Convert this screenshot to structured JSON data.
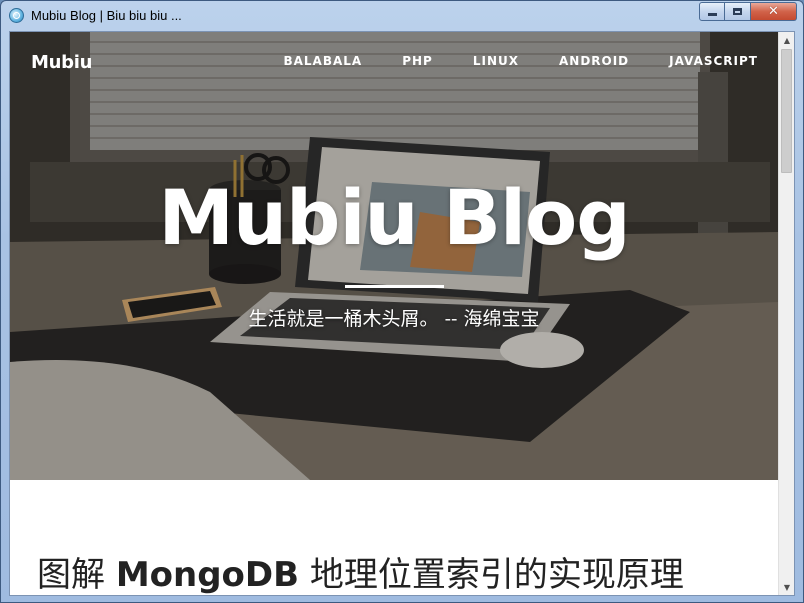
{
  "window": {
    "title": "Mubiu Blog | Biu biu biu ...",
    "minimize_glyph": "",
    "close_glyph": "✕"
  },
  "nav": {
    "brand": "Mubiu",
    "items": [
      {
        "label": "BALABALA"
      },
      {
        "label": "PHP"
      },
      {
        "label": "LINUX"
      },
      {
        "label": "ANDROID"
      },
      {
        "label": "JAVASCRIPT"
      }
    ]
  },
  "hero": {
    "title": "Mubiu Blog",
    "subtitle": "生活就是一桶木头屑。 -- 海绵宝宝"
  },
  "post": {
    "title_prefix": "图解 ",
    "title_latin": "MongoDB",
    "title_suffix": " 地理位置索引的实现原理"
  },
  "scrollbar": {
    "up_glyph": "▲",
    "down_glyph": "▼"
  },
  "colors": {
    "close_button": "#c44a30",
    "titlebar": "#a8c2e3",
    "hero_text": "#ffffff",
    "post_title": "#222222"
  }
}
